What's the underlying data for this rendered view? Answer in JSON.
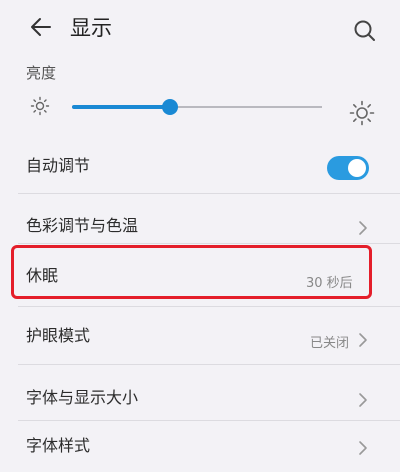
{
  "header": {
    "title": "显示"
  },
  "brightness": {
    "label": "亮度",
    "level_percent": 39
  },
  "auto_adjust": {
    "label": "自动调节",
    "enabled": true
  },
  "color_temp": {
    "label": "色彩调节与色温"
  },
  "sleep": {
    "label": "休眠",
    "value": "30 秒后"
  },
  "eye_care": {
    "label": "护眼模式",
    "value": "已关闭"
  },
  "font_size": {
    "label": "字体与显示大小"
  },
  "font_style": {
    "label": "字体样式"
  },
  "colors": {
    "accent": "#1989d4",
    "highlight": "#e41e2a"
  }
}
